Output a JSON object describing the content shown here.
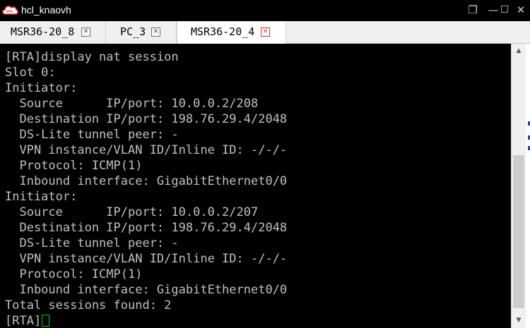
{
  "window": {
    "title": "hcl_knaovh",
    "icon": "cloud-logo-icon",
    "controls": {
      "restore_glyph": "❐",
      "minimize_glyph": "—",
      "maximize_glyph": "☐",
      "close_glyph": "✕"
    }
  },
  "tabs": [
    {
      "label": "MSR36-20_8",
      "active": false,
      "close_glyph": "✕"
    },
    {
      "label": "PC_3",
      "active": false,
      "close_glyph": "✕"
    },
    {
      "label": "MSR36-20_4",
      "active": true,
      "close_glyph": "✕"
    }
  ],
  "terminal": {
    "lines": [
      "[RTA]display nat session",
      "Slot 0:",
      "Initiator:",
      "  Source      IP/port: 10.0.0.2/208",
      "  Destination IP/port: 198.76.29.4/2048",
      "  DS-Lite tunnel peer: -",
      "  VPN instance/VLAN ID/Inline ID: -/-/-",
      "  Protocol: ICMP(1)",
      "  Inbound interface: GigabitEthernet0/0",
      "Initiator:",
      "  Source      IP/port: 10.0.0.2/207",
      "  Destination IP/port: 198.76.29.4/2048",
      "  DS-Lite tunnel peer: -",
      "  VPN instance/VLAN ID/Inline ID: -/-/-",
      "  Protocol: ICMP(1)",
      "  Inbound interface: GigabitEthernet0/0",
      "Total sessions found: 2"
    ],
    "prompt": "[RTA]",
    "text_color": "#c0c0c0",
    "background": "#000000",
    "cursor_color": "#00d000"
  },
  "scrollbar": {
    "position_fraction": 0.55,
    "up_glyph": "▲",
    "down_glyph": "▼"
  },
  "colors": {
    "titlebar": "#000000",
    "active_tab_close": "#e04020",
    "tab_background": "#f0f0f0"
  }
}
